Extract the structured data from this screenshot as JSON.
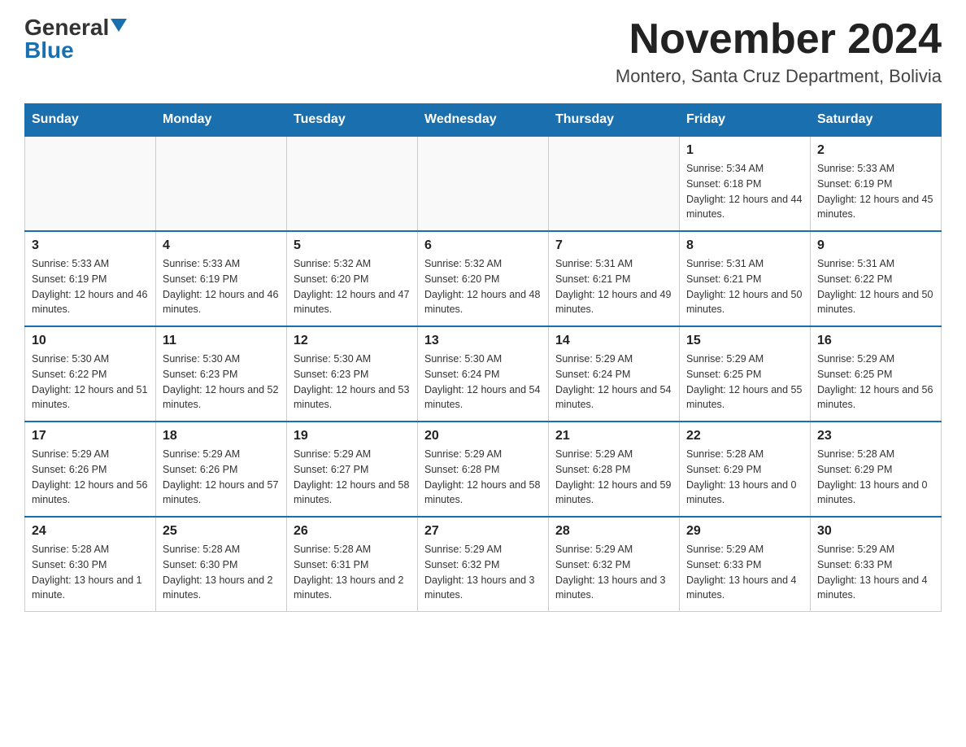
{
  "logo": {
    "general": "General",
    "blue": "Blue",
    "triangle": "▶"
  },
  "header": {
    "month": "November 2024",
    "location": "Montero, Santa Cruz Department, Bolivia"
  },
  "weekdays": [
    "Sunday",
    "Monday",
    "Tuesday",
    "Wednesday",
    "Thursday",
    "Friday",
    "Saturday"
  ],
  "rows": [
    [
      {
        "day": "",
        "sunrise": "",
        "sunset": "",
        "daylight": ""
      },
      {
        "day": "",
        "sunrise": "",
        "sunset": "",
        "daylight": ""
      },
      {
        "day": "",
        "sunrise": "",
        "sunset": "",
        "daylight": ""
      },
      {
        "day": "",
        "sunrise": "",
        "sunset": "",
        "daylight": ""
      },
      {
        "day": "",
        "sunrise": "",
        "sunset": "",
        "daylight": ""
      },
      {
        "day": "1",
        "sunrise": "Sunrise: 5:34 AM",
        "sunset": "Sunset: 6:18 PM",
        "daylight": "Daylight: 12 hours and 44 minutes."
      },
      {
        "day": "2",
        "sunrise": "Sunrise: 5:33 AM",
        "sunset": "Sunset: 6:19 PM",
        "daylight": "Daylight: 12 hours and 45 minutes."
      }
    ],
    [
      {
        "day": "3",
        "sunrise": "Sunrise: 5:33 AM",
        "sunset": "Sunset: 6:19 PM",
        "daylight": "Daylight: 12 hours and 46 minutes."
      },
      {
        "day": "4",
        "sunrise": "Sunrise: 5:33 AM",
        "sunset": "Sunset: 6:19 PM",
        "daylight": "Daylight: 12 hours and 46 minutes."
      },
      {
        "day": "5",
        "sunrise": "Sunrise: 5:32 AM",
        "sunset": "Sunset: 6:20 PM",
        "daylight": "Daylight: 12 hours and 47 minutes."
      },
      {
        "day": "6",
        "sunrise": "Sunrise: 5:32 AM",
        "sunset": "Sunset: 6:20 PM",
        "daylight": "Daylight: 12 hours and 48 minutes."
      },
      {
        "day": "7",
        "sunrise": "Sunrise: 5:31 AM",
        "sunset": "Sunset: 6:21 PM",
        "daylight": "Daylight: 12 hours and 49 minutes."
      },
      {
        "day": "8",
        "sunrise": "Sunrise: 5:31 AM",
        "sunset": "Sunset: 6:21 PM",
        "daylight": "Daylight: 12 hours and 50 minutes."
      },
      {
        "day": "9",
        "sunrise": "Sunrise: 5:31 AM",
        "sunset": "Sunset: 6:22 PM",
        "daylight": "Daylight: 12 hours and 50 minutes."
      }
    ],
    [
      {
        "day": "10",
        "sunrise": "Sunrise: 5:30 AM",
        "sunset": "Sunset: 6:22 PM",
        "daylight": "Daylight: 12 hours and 51 minutes."
      },
      {
        "day": "11",
        "sunrise": "Sunrise: 5:30 AM",
        "sunset": "Sunset: 6:23 PM",
        "daylight": "Daylight: 12 hours and 52 minutes."
      },
      {
        "day": "12",
        "sunrise": "Sunrise: 5:30 AM",
        "sunset": "Sunset: 6:23 PM",
        "daylight": "Daylight: 12 hours and 53 minutes."
      },
      {
        "day": "13",
        "sunrise": "Sunrise: 5:30 AM",
        "sunset": "Sunset: 6:24 PM",
        "daylight": "Daylight: 12 hours and 54 minutes."
      },
      {
        "day": "14",
        "sunrise": "Sunrise: 5:29 AM",
        "sunset": "Sunset: 6:24 PM",
        "daylight": "Daylight: 12 hours and 54 minutes."
      },
      {
        "day": "15",
        "sunrise": "Sunrise: 5:29 AM",
        "sunset": "Sunset: 6:25 PM",
        "daylight": "Daylight: 12 hours and 55 minutes."
      },
      {
        "day": "16",
        "sunrise": "Sunrise: 5:29 AM",
        "sunset": "Sunset: 6:25 PM",
        "daylight": "Daylight: 12 hours and 56 minutes."
      }
    ],
    [
      {
        "day": "17",
        "sunrise": "Sunrise: 5:29 AM",
        "sunset": "Sunset: 6:26 PM",
        "daylight": "Daylight: 12 hours and 56 minutes."
      },
      {
        "day": "18",
        "sunrise": "Sunrise: 5:29 AM",
        "sunset": "Sunset: 6:26 PM",
        "daylight": "Daylight: 12 hours and 57 minutes."
      },
      {
        "day": "19",
        "sunrise": "Sunrise: 5:29 AM",
        "sunset": "Sunset: 6:27 PM",
        "daylight": "Daylight: 12 hours and 58 minutes."
      },
      {
        "day": "20",
        "sunrise": "Sunrise: 5:29 AM",
        "sunset": "Sunset: 6:28 PM",
        "daylight": "Daylight: 12 hours and 58 minutes."
      },
      {
        "day": "21",
        "sunrise": "Sunrise: 5:29 AM",
        "sunset": "Sunset: 6:28 PM",
        "daylight": "Daylight: 12 hours and 59 minutes."
      },
      {
        "day": "22",
        "sunrise": "Sunrise: 5:28 AM",
        "sunset": "Sunset: 6:29 PM",
        "daylight": "Daylight: 13 hours and 0 minutes."
      },
      {
        "day": "23",
        "sunrise": "Sunrise: 5:28 AM",
        "sunset": "Sunset: 6:29 PM",
        "daylight": "Daylight: 13 hours and 0 minutes."
      }
    ],
    [
      {
        "day": "24",
        "sunrise": "Sunrise: 5:28 AM",
        "sunset": "Sunset: 6:30 PM",
        "daylight": "Daylight: 13 hours and 1 minute."
      },
      {
        "day": "25",
        "sunrise": "Sunrise: 5:28 AM",
        "sunset": "Sunset: 6:30 PM",
        "daylight": "Daylight: 13 hours and 2 minutes."
      },
      {
        "day": "26",
        "sunrise": "Sunrise: 5:28 AM",
        "sunset": "Sunset: 6:31 PM",
        "daylight": "Daylight: 13 hours and 2 minutes."
      },
      {
        "day": "27",
        "sunrise": "Sunrise: 5:29 AM",
        "sunset": "Sunset: 6:32 PM",
        "daylight": "Daylight: 13 hours and 3 minutes."
      },
      {
        "day": "28",
        "sunrise": "Sunrise: 5:29 AM",
        "sunset": "Sunset: 6:32 PM",
        "daylight": "Daylight: 13 hours and 3 minutes."
      },
      {
        "day": "29",
        "sunrise": "Sunrise: 5:29 AM",
        "sunset": "Sunset: 6:33 PM",
        "daylight": "Daylight: 13 hours and 4 minutes."
      },
      {
        "day": "30",
        "sunrise": "Sunrise: 5:29 AM",
        "sunset": "Sunset: 6:33 PM",
        "daylight": "Daylight: 13 hours and 4 minutes."
      }
    ]
  ]
}
